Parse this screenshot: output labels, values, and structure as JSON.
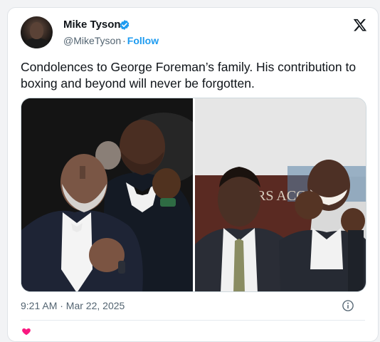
{
  "tweet": {
    "author_name": "Mike Tyson",
    "handle": "@MikeTyson",
    "separator": "·",
    "follow_label": "Follow",
    "text": "Condolences to George Foreman’s family. His contribution to boxing and beyond will never be forgotten.",
    "timestamp": "9:21 AM · Mar 22, 2025"
  },
  "media": {
    "images": [
      {
        "description_name": "tyson-foreman-recent-photo"
      },
      {
        "description_name": "tyson-foreman-vintage-photo"
      }
    ],
    "banner_text": "RS ACCA"
  },
  "colors": {
    "accent": "#1d9bf0",
    "text": "#0f1419",
    "muted": "#536471"
  },
  "icons": [
    "verified-badge-icon",
    "x-logo-icon",
    "info-icon"
  ]
}
